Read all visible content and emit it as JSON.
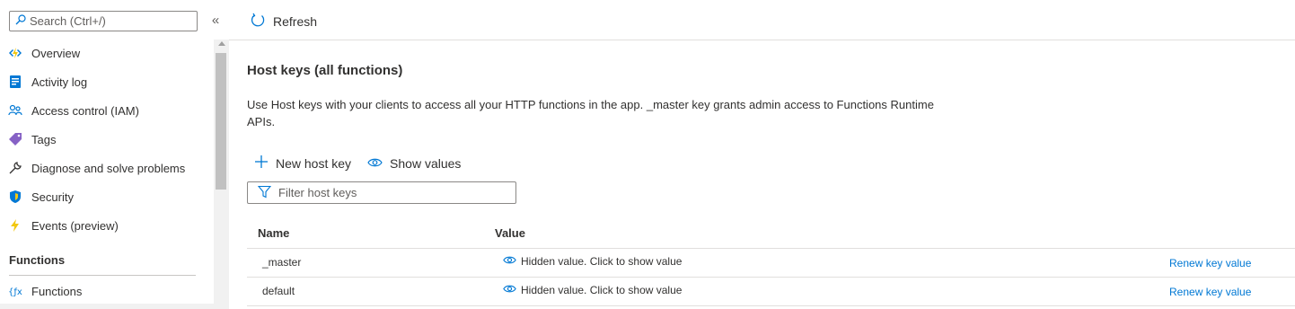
{
  "sidebar": {
    "search": {
      "placeholder": "Search (Ctrl+/)",
      "icon": "search-icon"
    },
    "collapse": {
      "label": "«",
      "icon": "double-chevron-left-icon"
    },
    "items": [
      {
        "label": "Overview",
        "icon": "function-app-icon",
        "color": "#f2c811"
      },
      {
        "label": "Activity log",
        "icon": "activity-log-icon",
        "color": "#0078d4"
      },
      {
        "label": "Access control (IAM)",
        "icon": "people-icon",
        "color": "#0078d4"
      },
      {
        "label": "Tags",
        "icon": "tag-icon",
        "color": "#8661c5"
      },
      {
        "label": "Diagnose and solve problems",
        "icon": "wrench-icon",
        "color": "#323130"
      },
      {
        "label": "Security",
        "icon": "shield-icon",
        "color": "#0078d4"
      },
      {
        "label": "Events (preview)",
        "icon": "lightning-icon",
        "color": "#f2c811"
      }
    ],
    "section": {
      "label": "Functions"
    },
    "functions_item": {
      "label": "Functions",
      "icon": "function-braces-icon",
      "color": "#0078d4"
    }
  },
  "toolbar": {
    "refresh_label": "Refresh",
    "refresh_icon": "refresh-icon"
  },
  "main": {
    "title": "Host keys (all functions)",
    "description": "Use Host keys with your clients to access all your HTTP functions in the app. _master key grants admin access to Functions Runtime APIs.",
    "actions": [
      {
        "label": "New host key",
        "icon": "plus-icon"
      },
      {
        "label": "Show values",
        "icon": "eye-icon"
      }
    ],
    "filter": {
      "placeholder": "Filter host keys",
      "icon": "filter-icon"
    },
    "table": {
      "columns": [
        "Name",
        "Value"
      ],
      "rows": [
        {
          "name": "_master",
          "value": "Hidden value. Click to show value",
          "action": "Renew key value"
        },
        {
          "name": "default",
          "value": "Hidden value. Click to show value",
          "action": "Renew key value"
        }
      ]
    }
  },
  "colors": {
    "accent": "#0078d4",
    "text": "#323130",
    "border": "#8a8886"
  }
}
